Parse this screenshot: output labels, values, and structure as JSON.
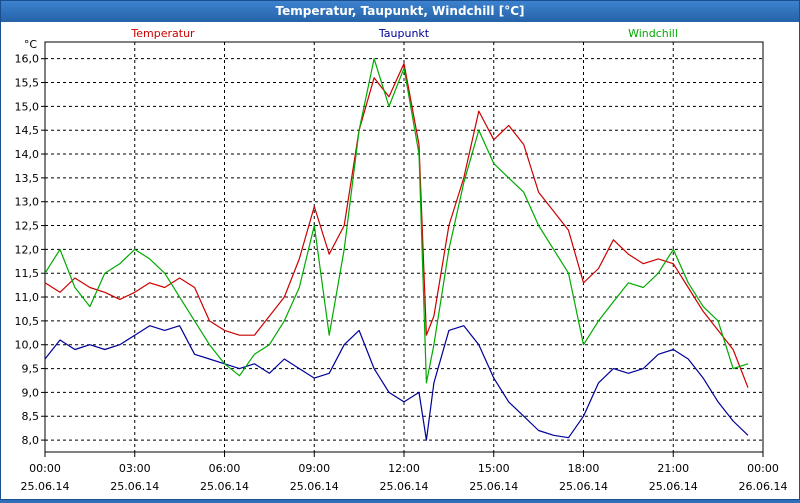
{
  "window": {
    "title": "Temperatur, Taupunkt, Windchill [°C]"
  },
  "chart_data": {
    "type": "line",
    "title": "Temperatur, Taupunkt, Windchill [°C]",
    "ylabel": "°C",
    "ylim": [
      7.75,
      16.35
    ],
    "yticks": [
      8.0,
      8.5,
      9.0,
      9.5,
      10.0,
      10.5,
      11.0,
      11.5,
      12.0,
      12.5,
      13.0,
      13.5,
      14.0,
      14.5,
      15.0,
      15.5,
      16.0
    ],
    "ytick_labels": [
      "8,0",
      "8,5",
      "9,0",
      "9,5",
      "10,0",
      "10,5",
      "11,0",
      "11,5",
      "12,0",
      "12,5",
      "13,0",
      "13,5",
      "14,0",
      "14,5",
      "15,0",
      "15,5",
      "16,0"
    ],
    "xlim": [
      0,
      24
    ],
    "xticks": [
      0,
      3,
      6,
      9,
      12,
      15,
      18,
      21,
      24
    ],
    "xtick_labels": [
      {
        "time": "00:00",
        "date": "25.06.14"
      },
      {
        "time": "03:00",
        "date": "25.06.14"
      },
      {
        "time": "06:00",
        "date": "25.06.14"
      },
      {
        "time": "09:00",
        "date": "25.06.14"
      },
      {
        "time": "12:00",
        "date": "25.06.14"
      },
      {
        "time": "15:00",
        "date": "25.06.14"
      },
      {
        "time": "18:00",
        "date": "25.06.14"
      },
      {
        "time": "21:00",
        "date": "25.06.14"
      },
      {
        "time": "00:00",
        "date": "26.06.14"
      }
    ],
    "grid": true,
    "legend": "top",
    "series": [
      {
        "name": "Temperatur",
        "color": "#cc0000",
        "points": [
          [
            0,
            11.3
          ],
          [
            0.5,
            11.1
          ],
          [
            1,
            11.4
          ],
          [
            1.5,
            11.2
          ],
          [
            2,
            11.1
          ],
          [
            2.5,
            10.95
          ],
          [
            3,
            11.1
          ],
          [
            3.5,
            11.3
          ],
          [
            4,
            11.2
          ],
          [
            4.5,
            11.4
          ],
          [
            5,
            11.2
          ],
          [
            5.5,
            10.5
          ],
          [
            6,
            10.3
          ],
          [
            6.5,
            10.2
          ],
          [
            7,
            10.2
          ],
          [
            7.5,
            10.6
          ],
          [
            8,
            11.0
          ],
          [
            8.5,
            11.8
          ],
          [
            9,
            12.9
          ],
          [
            9.5,
            11.9
          ],
          [
            10,
            12.5
          ],
          [
            10.5,
            14.5
          ],
          [
            11,
            15.6
          ],
          [
            11.5,
            15.2
          ],
          [
            12,
            15.9
          ],
          [
            12.5,
            14.2
          ],
          [
            12.75,
            10.2
          ],
          [
            13,
            10.6
          ],
          [
            13.5,
            12.5
          ],
          [
            14,
            13.5
          ],
          [
            14.5,
            14.9
          ],
          [
            15,
            14.3
          ],
          [
            15.5,
            14.6
          ],
          [
            16,
            14.2
          ],
          [
            16.5,
            13.2
          ],
          [
            17,
            12.8
          ],
          [
            17.5,
            12.4
          ],
          [
            18,
            11.3
          ],
          [
            18.5,
            11.6
          ],
          [
            19,
            12.2
          ],
          [
            19.5,
            11.9
          ],
          [
            20,
            11.7
          ],
          [
            20.5,
            11.8
          ],
          [
            21,
            11.7
          ],
          [
            21.5,
            11.2
          ],
          [
            22,
            10.7
          ],
          [
            22.5,
            10.3
          ],
          [
            23,
            9.9
          ],
          [
            23.5,
            9.1
          ]
        ]
      },
      {
        "name": "Taupunkt",
        "color": "#000099",
        "points": [
          [
            0,
            9.7
          ],
          [
            0.5,
            10.1
          ],
          [
            1,
            9.9
          ],
          [
            1.5,
            10.0
          ],
          [
            2,
            9.9
          ],
          [
            2.5,
            10.0
          ],
          [
            3,
            10.2
          ],
          [
            3.5,
            10.4
          ],
          [
            4,
            10.3
          ],
          [
            4.5,
            10.4
          ],
          [
            5,
            9.8
          ],
          [
            5.5,
            9.7
          ],
          [
            6,
            9.6
          ],
          [
            6.5,
            9.5
          ],
          [
            7,
            9.6
          ],
          [
            7.5,
            9.4
          ],
          [
            8,
            9.7
          ],
          [
            8.5,
            9.5
          ],
          [
            9,
            9.3
          ],
          [
            9.5,
            9.4
          ],
          [
            10,
            10.0
          ],
          [
            10.5,
            10.3
          ],
          [
            11,
            9.5
          ],
          [
            11.5,
            9.0
          ],
          [
            12,
            8.8
          ],
          [
            12.5,
            9.0
          ],
          [
            12.75,
            8.0
          ],
          [
            13,
            9.2
          ],
          [
            13.5,
            10.3
          ],
          [
            14,
            10.4
          ],
          [
            14.5,
            10.0
          ],
          [
            15,
            9.3
          ],
          [
            15.5,
            8.8
          ],
          [
            16,
            8.5
          ],
          [
            16.5,
            8.2
          ],
          [
            17,
            8.1
          ],
          [
            17.5,
            8.05
          ],
          [
            18,
            8.5
          ],
          [
            18.5,
            9.2
          ],
          [
            19,
            9.5
          ],
          [
            19.5,
            9.4
          ],
          [
            20,
            9.5
          ],
          [
            20.5,
            9.8
          ],
          [
            21,
            9.9
          ],
          [
            21.5,
            9.7
          ],
          [
            22,
            9.3
          ],
          [
            22.5,
            8.8
          ],
          [
            23,
            8.4
          ],
          [
            23.5,
            8.1
          ]
        ]
      },
      {
        "name": "Windchill",
        "color": "#00aa00",
        "points": [
          [
            0,
            11.5
          ],
          [
            0.5,
            12.0
          ],
          [
            1,
            11.2
          ],
          [
            1.5,
            10.8
          ],
          [
            2,
            11.5
          ],
          [
            2.5,
            11.7
          ],
          [
            3,
            12.0
          ],
          [
            3.5,
            11.8
          ],
          [
            4,
            11.5
          ],
          [
            4.5,
            11.0
          ],
          [
            5,
            10.5
          ],
          [
            5.5,
            10.0
          ],
          [
            6,
            9.6
          ],
          [
            6.5,
            9.35
          ],
          [
            7,
            9.8
          ],
          [
            7.5,
            10.0
          ],
          [
            8,
            10.5
          ],
          [
            8.5,
            11.2
          ],
          [
            9,
            12.5
          ],
          [
            9.5,
            10.2
          ],
          [
            10,
            12.0
          ],
          [
            10.5,
            14.5
          ],
          [
            11,
            16.0
          ],
          [
            11.5,
            15.0
          ],
          [
            12,
            15.8
          ],
          [
            12.5,
            14.0
          ],
          [
            12.75,
            9.2
          ],
          [
            13,
            10.0
          ],
          [
            13.5,
            12.0
          ],
          [
            14,
            13.4
          ],
          [
            14.5,
            14.5
          ],
          [
            15,
            13.8
          ],
          [
            15.5,
            13.5
          ],
          [
            16,
            13.2
          ],
          [
            16.5,
            12.5
          ],
          [
            17,
            12.0
          ],
          [
            17.5,
            11.5
          ],
          [
            18,
            10.0
          ],
          [
            18.5,
            10.5
          ],
          [
            19,
            10.9
          ],
          [
            19.5,
            11.3
          ],
          [
            20,
            11.2
          ],
          [
            20.5,
            11.5
          ],
          [
            21,
            12.0
          ],
          [
            21.5,
            11.3
          ],
          [
            22,
            10.8
          ],
          [
            22.5,
            10.5
          ],
          [
            23,
            9.5
          ],
          [
            23.5,
            9.6
          ]
        ]
      }
    ]
  }
}
